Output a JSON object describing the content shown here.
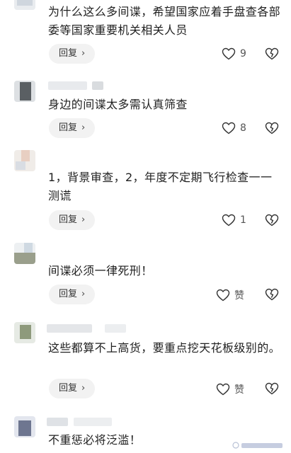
{
  "comments": [
    {
      "text": "为什么这么多间谍，希望国家应着手盘查各部委等国家重要机关相关人员",
      "reply_label": "回复",
      "likes": "9"
    },
    {
      "text": "身边的间谍太多需认真筛查",
      "reply_label": "回复",
      "likes": "8"
    },
    {
      "text": "1，背景审查，2，年度不定期飞行检查一一测谎",
      "reply_label": "回复",
      "likes": "1"
    },
    {
      "text": "间谍必须一律死刑！",
      "reply_label": "回复",
      "likes": "赞"
    },
    {
      "text": "这些都算不上高货，要重点挖天花板级别的。",
      "reply_label": "回复",
      "likes": "赞"
    },
    {
      "text": "不重惩必将泛滥！"
    }
  ],
  "icons": {
    "chevron": "›",
    "like": "heart-icon",
    "dislike": "broken-heart-icon"
  },
  "colors": {
    "reply_bg": "#f2f2f2",
    "icon_stroke": "#333333"
  }
}
